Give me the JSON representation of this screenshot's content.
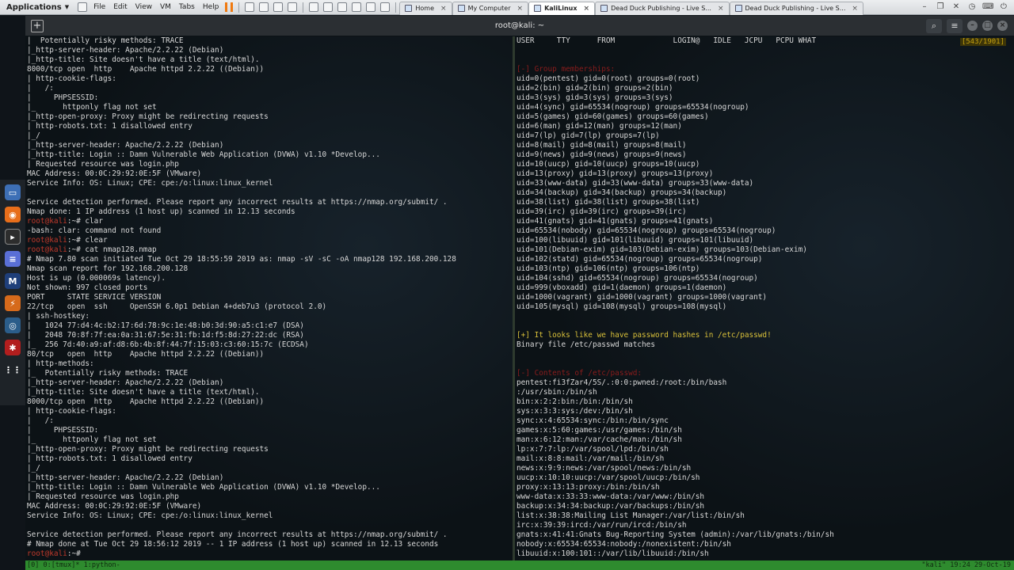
{
  "host": {
    "apps_label": "Applications",
    "menu": [
      "File",
      "Edit",
      "View",
      "VM",
      "Tabs",
      "Help"
    ],
    "tabs": [
      {
        "label": "Home",
        "active": false
      },
      {
        "label": "My Computer",
        "active": false
      },
      {
        "label": "KaliLinux",
        "active": true
      },
      {
        "label": "Dead Duck Publishing - Live S...",
        "active": false
      },
      {
        "label": "Dead Duck Publishing - Live S...",
        "active": false
      }
    ],
    "tray_icons": [
      "minimize-icon",
      "restore-icon",
      "close-icon",
      "clock-icon",
      "keyboard-icon",
      "power-icon"
    ]
  },
  "terminal": {
    "title": "root@kali: ~",
    "header_buttons": [
      "search-icon",
      "hamburger-icon",
      "minimize-icon",
      "maximize-icon",
      "close-icon"
    ]
  },
  "left_pane": [
    {
      "t": "|  Potentially risky methods: TRACE"
    },
    {
      "t": "|_http-server-header: Apache/2.2.22 (Debian)"
    },
    {
      "t": "|_http-title: Site doesn't have a title (text/html)."
    },
    {
      "t": "8000/tcp open  http    Apache httpd 2.2.22 ((Debian))"
    },
    {
      "t": "| http-cookie-flags:"
    },
    {
      "t": "|   /:"
    },
    {
      "t": "|     PHPSESSID:"
    },
    {
      "t": "|_      httponly flag not set"
    },
    {
      "t": "|_http-open-proxy: Proxy might be redirecting requests"
    },
    {
      "t": "| http-robots.txt: 1 disallowed entry"
    },
    {
      "t": "|_/"
    },
    {
      "t": "|_http-server-header: Apache/2.2.22 (Debian)"
    },
    {
      "t": "|_http-title: Login :: Damn Vulnerable Web Application (DVWA) v1.10 *Develop..."
    },
    {
      "t": "| Requested resource was login.php"
    },
    {
      "t": "MAC Address: 00:0C:29:92:0E:5F (VMware)"
    },
    {
      "t": "Service Info: OS: Linux; CPE: cpe:/o:linux:linux_kernel"
    },
    {
      "t": ""
    },
    {
      "t": "Service detection performed. Please report any incorrect results at https://nmap.org/submit/ ."
    },
    {
      "t": "Nmap done: 1 IP address (1 host up) scanned in 12.13 seconds"
    },
    {
      "p": "root@kali",
      "t": ":~# clar"
    },
    {
      "t": "-bash: clar: command not found"
    },
    {
      "p": "root@kali",
      "t": ":~# clear"
    },
    {
      "p": "root@kali",
      "t": ":~# cat nmap128.nmap"
    },
    {
      "t": "# Nmap 7.80 scan initiated Tue Oct 29 18:55:59 2019 as: nmap -sV -sC -oA nmap128 192.168.200.128"
    },
    {
      "t": "Nmap scan report for 192.168.200.128"
    },
    {
      "t": "Host is up (0.000069s latency)."
    },
    {
      "t": "Not shown: 997 closed ports"
    },
    {
      "t": "PORT     STATE SERVICE VERSION"
    },
    {
      "t": "22/tcp   open  ssh     OpenSSH 6.0p1 Debian 4+deb7u3 (protocol 2.0)"
    },
    {
      "t": "| ssh-hostkey:"
    },
    {
      "t": "|   1024 77:d4:4c:b2:17:6d:78:9c:1e:48:b0:3d:90:a5:c1:e7 (DSA)"
    },
    {
      "t": "|   2048 70:8f:7f:ea:0a:31:67:5e:31:fb:1d:f5:8d:27:22:dc (RSA)"
    },
    {
      "t": "|_  256 7d:40:a9:af:d8:6b:4b:8f:44:7f:15:03:c3:60:15:7c (ECDSA)"
    },
    {
      "t": "80/tcp   open  http    Apache httpd 2.2.22 ((Debian))"
    },
    {
      "t": "| http-methods:"
    },
    {
      "t": "|_  Potentially risky methods: TRACE"
    },
    {
      "t": "|_http-server-header: Apache/2.2.22 (Debian)"
    },
    {
      "t": "|_http-title: Site doesn't have a title (text/html)."
    },
    {
      "t": "8000/tcp open  http    Apache httpd 2.2.22 ((Debian))"
    },
    {
      "t": "| http-cookie-flags:"
    },
    {
      "t": "|   /:"
    },
    {
      "t": "|     PHPSESSID:"
    },
    {
      "t": "|_      httponly flag not set"
    },
    {
      "t": "|_http-open-proxy: Proxy might be redirecting requests"
    },
    {
      "t": "| http-robots.txt: 1 disallowed entry"
    },
    {
      "t": "|_/"
    },
    {
      "t": "|_http-server-header: Apache/2.2.22 (Debian)"
    },
    {
      "t": "|_http-title: Login :: Damn Vulnerable Web Application (DVWA) v1.10 *Develop..."
    },
    {
      "t": "| Requested resource was login.php"
    },
    {
      "t": "MAC Address: 00:0C:29:92:0E:5F (VMware)"
    },
    {
      "t": "Service Info: OS: Linux; CPE: cpe:/o:linux:linux_kernel"
    },
    {
      "t": ""
    },
    {
      "t": "Service detection performed. Please report any incorrect results at https://nmap.org/submit/ ."
    },
    {
      "t": "# Nmap done at Tue Oct 29 18:56:12 2019 -- 1 IP address (1 host up) scanned in 12.13 seconds"
    },
    {
      "p": "root@kali",
      "t": ":~# "
    }
  ],
  "right_pane": {
    "header": "USER     TTY      FROM             LOGIN@   IDLE   JCPU   PCPU WHAT",
    "position_badge": "[543/1901]",
    "lines": [
      {
        "t": ""
      },
      {
        "t": ""
      },
      {
        "c": "redhdr",
        "t": "[-] Group memberships:"
      },
      {
        "t": "uid=0(pentest) gid=0(root) groups=0(root)"
      },
      {
        "t": "uid=2(bin) gid=2(bin) groups=2(bin)"
      },
      {
        "t": "uid=3(sys) gid=3(sys) groups=3(sys)"
      },
      {
        "t": "uid=4(sync) gid=65534(nogroup) groups=65534(nogroup)"
      },
      {
        "t": "uid=5(games) gid=60(games) groups=60(games)"
      },
      {
        "t": "uid=6(man) gid=12(man) groups=12(man)"
      },
      {
        "t": "uid=7(lp) gid=7(lp) groups=7(lp)"
      },
      {
        "t": "uid=8(mail) gid=8(mail) groups=8(mail)"
      },
      {
        "t": "uid=9(news) gid=9(news) groups=9(news)"
      },
      {
        "t": "uid=10(uucp) gid=10(uucp) groups=10(uucp)"
      },
      {
        "t": "uid=13(proxy) gid=13(proxy) groups=13(proxy)"
      },
      {
        "t": "uid=33(www-data) gid=33(www-data) groups=33(www-data)"
      },
      {
        "t": "uid=34(backup) gid=34(backup) groups=34(backup)"
      },
      {
        "t": "uid=38(list) gid=38(list) groups=38(list)"
      },
      {
        "t": "uid=39(irc) gid=39(irc) groups=39(irc)"
      },
      {
        "t": "uid=41(gnats) gid=41(gnats) groups=41(gnats)"
      },
      {
        "t": "uid=65534(nobody) gid=65534(nogroup) groups=65534(nogroup)"
      },
      {
        "t": "uid=100(libuuid) gid=101(libuuid) groups=101(libuuid)"
      },
      {
        "t": "uid=101(Debian-exim) gid=103(Debian-exim) groups=103(Debian-exim)"
      },
      {
        "t": "uid=102(statd) gid=65534(nogroup) groups=65534(nogroup)"
      },
      {
        "t": "uid=103(ntp) gid=106(ntp) groups=106(ntp)"
      },
      {
        "t": "uid=104(sshd) gid=65534(nogroup) groups=65534(nogroup)"
      },
      {
        "t": "uid=999(vboxadd) gid=1(daemon) groups=1(daemon)"
      },
      {
        "t": "uid=1000(vagrant) gid=1000(vagrant) groups=1000(vagrant)"
      },
      {
        "t": "uid=105(mysql) gid=108(mysql) groups=108(mysql)"
      },
      {
        "t": ""
      },
      {
        "t": ""
      },
      {
        "c": "yellow",
        "t": "[+] It looks like we have password hashes in /etc/passwd!"
      },
      {
        "t": "Binary file /etc/passwd matches"
      },
      {
        "t": ""
      },
      {
        "t": ""
      },
      {
        "c": "redhdr",
        "t": "[-] Contents of /etc/passwd:"
      },
      {
        "t": "pentest:fi3fZar4/5S/.:0:0:pwned:/root:/bin/bash"
      },
      {
        "t": ":/usr/sbin:/bin/sh"
      },
      {
        "t": "bin:x:2:2:bin:/bin:/bin/sh"
      },
      {
        "t": "sys:x:3:3:sys:/dev:/bin/sh"
      },
      {
        "t": "sync:x:4:65534:sync:/bin:/bin/sync"
      },
      {
        "t": "games:x:5:60:games:/usr/games:/bin/sh"
      },
      {
        "t": "man:x:6:12:man:/var/cache/man:/bin/sh"
      },
      {
        "t": "lp:x:7:7:lp:/var/spool/lpd:/bin/sh"
      },
      {
        "t": "mail:x:8:8:mail:/var/mail:/bin/sh"
      },
      {
        "t": "news:x:9:9:news:/var/spool/news:/bin/sh"
      },
      {
        "t": "uucp:x:10:10:uucp:/var/spool/uucp:/bin/sh"
      },
      {
        "t": "proxy:x:13:13:proxy:/bin:/bin/sh"
      },
      {
        "t": "www-data:x:33:33:www-data:/var/www:/bin/sh"
      },
      {
        "t": "backup:x:34:34:backup:/var/backups:/bin/sh"
      },
      {
        "t": "list:x:38:38:Mailing List Manager:/var/list:/bin/sh"
      },
      {
        "t": "irc:x:39:39:ircd:/var/run/ircd:/bin/sh"
      },
      {
        "t": "gnats:x:41:41:Gnats Bug-Reporting System (admin):/var/lib/gnats:/bin/sh"
      },
      {
        "t": "nobody:x:65534:65534:nobody:/nonexistent:/bin/sh"
      },
      {
        "t": "libuuid:x:100:101::/var/lib/libuuid:/bin/sh"
      }
    ]
  },
  "tmux": {
    "left": "[0] 0:[tmux]* 1:python-",
    "right": "\"kali\" 19:24 29-Oct-19"
  },
  "colors": {
    "prompt_red": "#c0392b",
    "header_red": "#8a1c1c",
    "highlight_yellow": "#d9c03a",
    "tmux_green": "#2e8b2e"
  }
}
